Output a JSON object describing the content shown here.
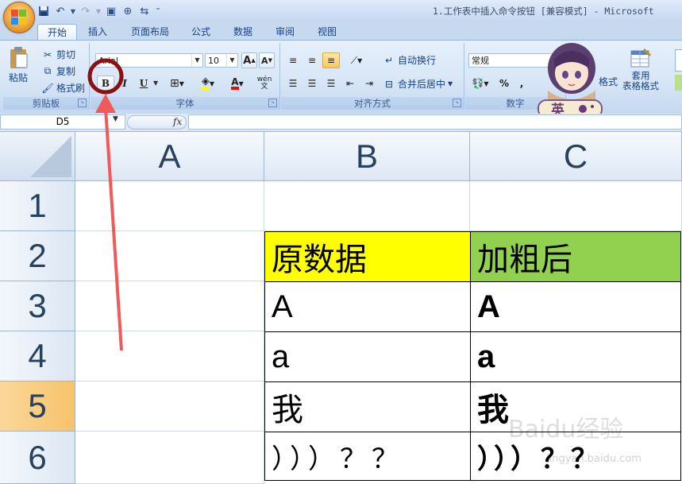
{
  "window": {
    "title": "1.工作表中插入命令按钮  [兼容模式] - Microsoft"
  },
  "tabs": [
    "开始",
    "插入",
    "页面布局",
    "公式",
    "数据",
    "审阅",
    "视图"
  ],
  "ribbon": {
    "clipboard": {
      "label": "剪贴板",
      "paste": "粘贴",
      "cut": "剪切",
      "copy": "复制",
      "format_painter": "格式刷"
    },
    "font": {
      "label": "字体",
      "font_name": "Arial",
      "font_size": "10",
      "bold": "B",
      "italic": "I",
      "underline": "U"
    },
    "alignment": {
      "label": "对齐方式",
      "wrap_text": "自动换行",
      "merge_center": "合并后居中"
    },
    "number": {
      "label": "数字",
      "format": "常规",
      "percent": "%",
      "comma": ","
    },
    "styles": {
      "cond_format_fragment": "格式",
      "table_format": "套用\n表格格式"
    }
  },
  "formula_bar": {
    "name_box": "D5",
    "fx": "fx"
  },
  "sheet": {
    "columns": [
      "A",
      "B",
      "C"
    ],
    "rows": [
      "1",
      "2",
      "3",
      "4",
      "5",
      "6"
    ],
    "selected_row": "5",
    "cells": {
      "B2": "原数据",
      "C2": "加粗后",
      "B3": "A",
      "C3": "A",
      "B4": "a",
      "C4": "a",
      "B5": "我",
      "C5": "我",
      "B6": "）））？？",
      "C6": "）））？？"
    },
    "colors": {
      "B2_fill": "#ffff00",
      "C2_fill": "#92d050"
    }
  },
  "overlay": {
    "sticker_text": "英",
    "watermark": "Baidu经验",
    "watermark_url": "jingyan.baidu.com",
    "annotation_color": "#f05a5a",
    "circle_color": "#8b1010"
  }
}
